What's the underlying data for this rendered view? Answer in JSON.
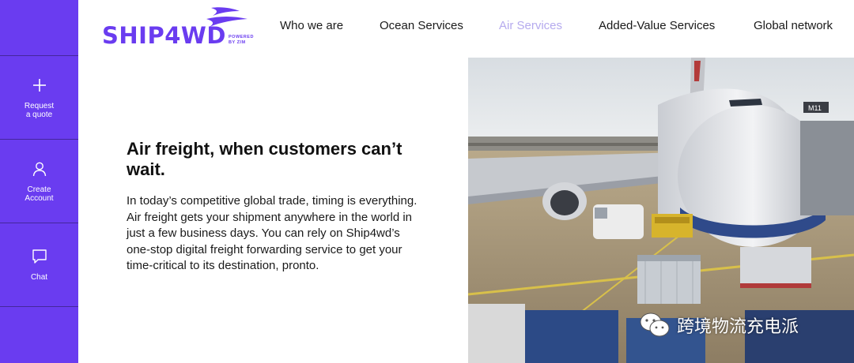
{
  "brand": {
    "name": "SHIP4WD",
    "powered_by": "POWERED\nBY ZIM",
    "primary_color": "#6a3cf0",
    "active_nav_color": "#b5aaee"
  },
  "sidebar": {
    "items": [
      {
        "label": "Request\na quote",
        "icon": "plus-icon"
      },
      {
        "label": "Create\nAccount",
        "icon": "user-icon"
      },
      {
        "label": "Chat",
        "icon": "chat-icon"
      }
    ]
  },
  "nav": {
    "items": [
      {
        "label": "Who we are",
        "active": false
      },
      {
        "label": "Ocean Services",
        "active": false
      },
      {
        "label": "Air Services",
        "active": true
      },
      {
        "label": "Added-Value Services",
        "active": false
      },
      {
        "label": "Global network",
        "active": false
      }
    ]
  },
  "hero": {
    "title": "Air freight, when customers can’t wait.",
    "body": "In today’s competitive global trade, timing is everything. Air freight gets your shipment anywhere in the world in just a few business days. You can rely on Ship4wd’s one-stop digital freight forwarding service to get your time-critical to its destination, pronto."
  },
  "watermark": {
    "text": "跨境物流充电派",
    "icon": "wechat-icon"
  }
}
